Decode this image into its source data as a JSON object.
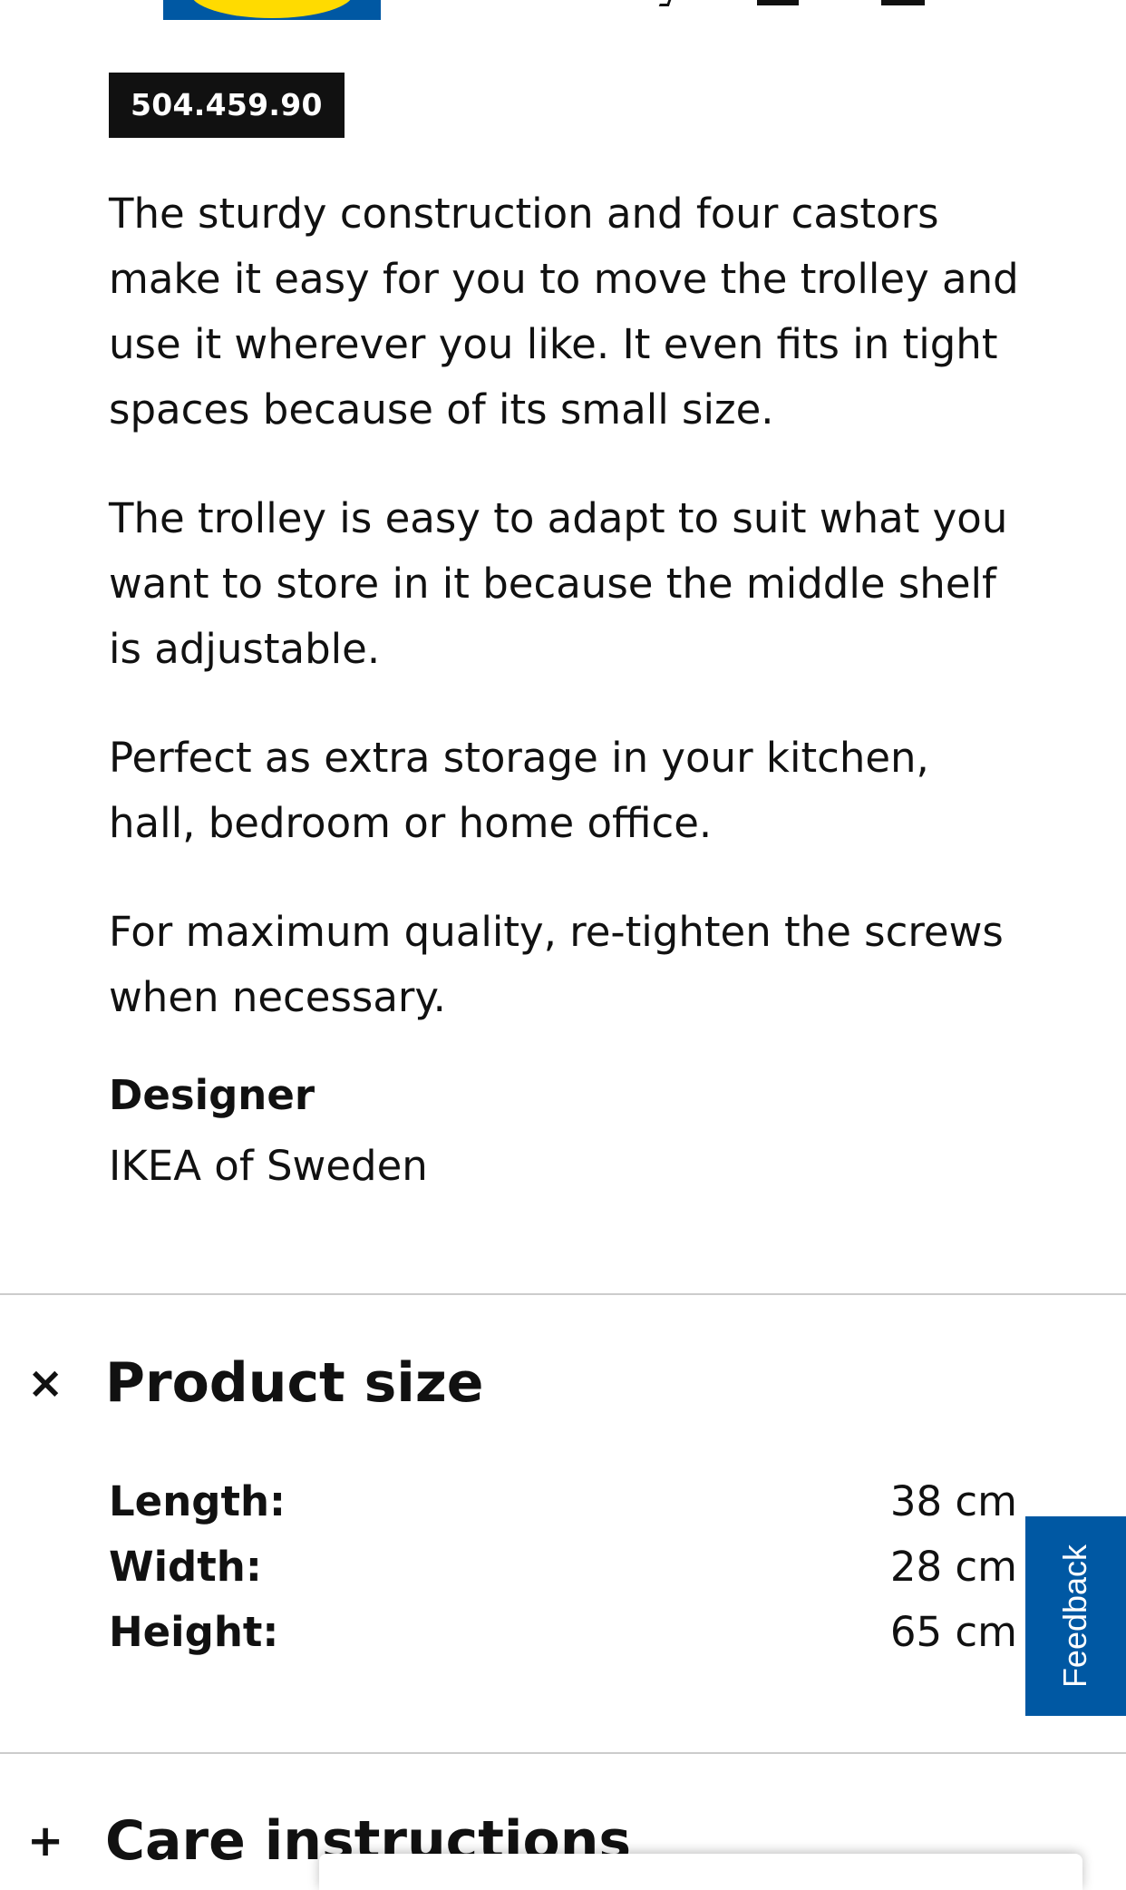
{
  "article_number": "504.459.90",
  "description": {
    "paragraphs": [
      "The sturdy construction and four castors make it easy for you to move the trolley and use it wherever you like. It even fits in tight spaces because of its small size.",
      "The trolley is easy to adapt to suit what you want to store in it because the middle shelf is adjustable.",
      "Perfect as extra storage in your kitchen, hall, bedroom or home office.",
      "For maximum quality, re-tighten the screws when necessary."
    ],
    "designer_label": "Designer",
    "designer_value": "IKEA of Sweden"
  },
  "sections": {
    "product_size": {
      "icon": "×",
      "icon_name": "close-icon",
      "title": "Product size",
      "rows": [
        {
          "label": "Length:",
          "value": "38 cm"
        },
        {
          "label": "Width:",
          "value": "28 cm"
        },
        {
          "label": "Height:",
          "value": "65 cm"
        }
      ]
    },
    "care_instructions": {
      "icon": "+",
      "icon_name": "plus-icon",
      "title": "Care instructions"
    }
  },
  "feedback": {
    "label": "Feedback"
  },
  "colors": {
    "brand_blue": "#0058a3",
    "brand_yellow": "#ffdb00",
    "text": "#111111",
    "divider": "#cccccc"
  }
}
